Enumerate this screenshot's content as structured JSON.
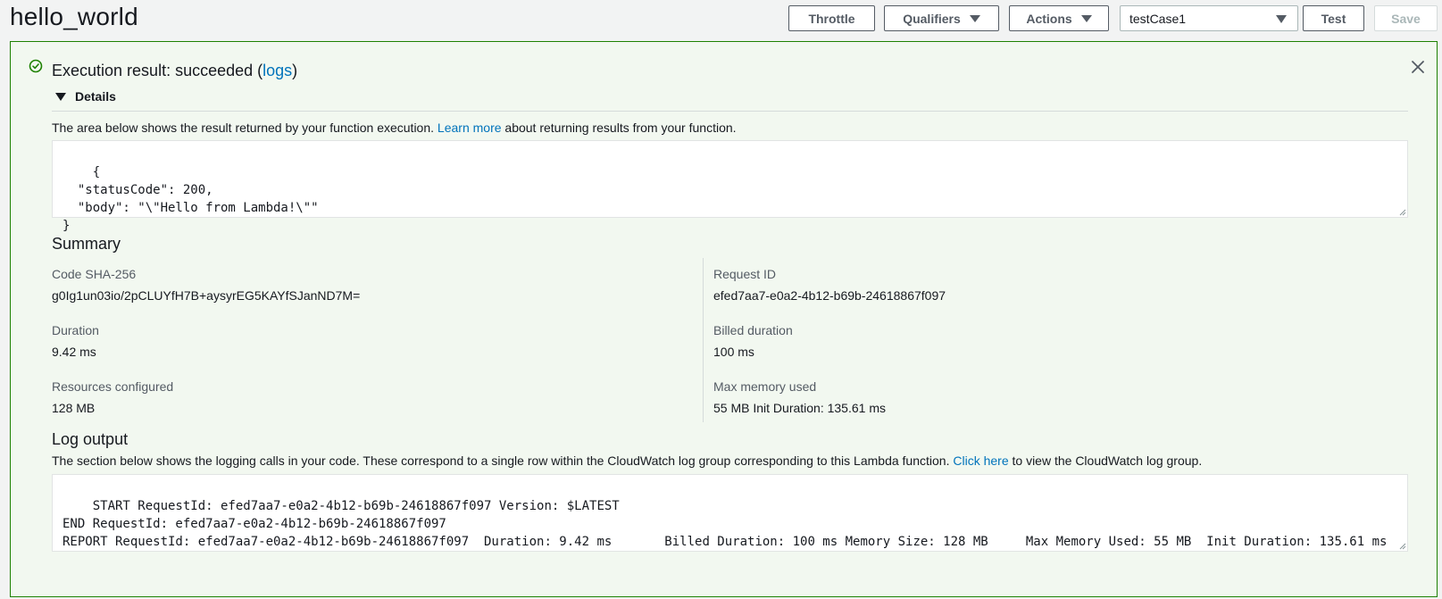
{
  "header": {
    "function_name": "hello_world",
    "throttle_label": "Throttle",
    "qualifiers_label": "Qualifiers",
    "actions_label": "Actions",
    "test_event_selected": "testCase1",
    "test_label": "Test",
    "save_label": "Save"
  },
  "result": {
    "title_prefix": "Execution result: succeeded (",
    "logs_link": "logs",
    "title_suffix": ")",
    "details_label": "Details",
    "desc_prefix": "The area below shows the result returned by your function execution. ",
    "learn_more_link": "Learn more",
    "desc_suffix": " about returning results from your function.",
    "output_json": "{\n  \"statusCode\": 200,\n  \"body\": \"\\\"Hello from Lambda!\\\"\"\n}"
  },
  "summary": {
    "heading": "Summary",
    "code_sha_label": "Code SHA-256",
    "code_sha_value": "g0Ig1un03io/2pCLUYfH7B+aysyrEG5KAYfSJanND7M=",
    "request_id_label": "Request ID",
    "request_id_value": "efed7aa7-e0a2-4b12-b69b-24618867f097",
    "duration_label": "Duration",
    "duration_value": "9.42 ms",
    "billed_label": "Billed duration",
    "billed_value": "100 ms",
    "resources_label": "Resources configured",
    "resources_value": "128 MB",
    "max_memory_label": "Max memory used",
    "max_memory_value": "55 MB Init Duration: 135.61 ms"
  },
  "log": {
    "heading": "Log output",
    "desc_prefix": "The section below shows the logging calls in your code. These correspond to a single row within the CloudWatch log group corresponding to this Lambda function. ",
    "click_here_link": "Click here",
    "desc_suffix": " to view the CloudWatch log group.",
    "output_text": "START RequestId: efed7aa7-e0a2-4b12-b69b-24618867f097 Version: $LATEST\nEND RequestId: efed7aa7-e0a2-4b12-b69b-24618867f097\nREPORT RequestId: efed7aa7-e0a2-4b12-b69b-24618867f097  Duration: 9.42 ms       Billed Duration: 100 ms Memory Size: 128 MB     Max Memory Used: 55 MB  Init Duration: 135.61 ms"
  },
  "colors": {
    "success_green": "#1d8102",
    "link_blue": "#0073bb",
    "panel_bg": "#f2f8f0"
  },
  "icons": [
    "success-check-icon",
    "close-icon",
    "caret-down-icon",
    "expand-triangle-icon",
    "resize-grip-icon"
  ]
}
